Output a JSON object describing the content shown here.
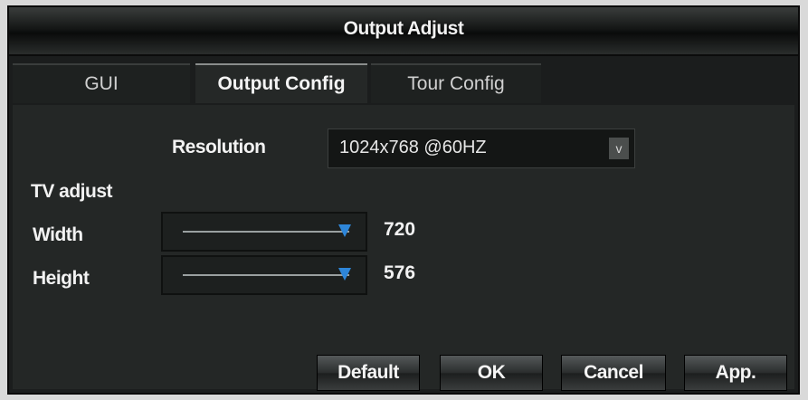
{
  "window": {
    "title": "Output Adjust"
  },
  "tabs": [
    {
      "label": "GUI"
    },
    {
      "label": "Output Config"
    },
    {
      "label": "Tour Config"
    }
  ],
  "resolution": {
    "label": "Resolution",
    "value": "1024x768 @60HZ",
    "arrow": "v"
  },
  "tv_adjust": {
    "heading": "TV adjust",
    "width": {
      "label": "Width",
      "value": "720"
    },
    "height": {
      "label": "Height",
      "value": "576"
    }
  },
  "buttons": {
    "default": "Default",
    "ok": "OK",
    "cancel": "Cancel",
    "apply": "App."
  },
  "colors": {
    "accent": "#2e86d9",
    "background": "#242726"
  }
}
